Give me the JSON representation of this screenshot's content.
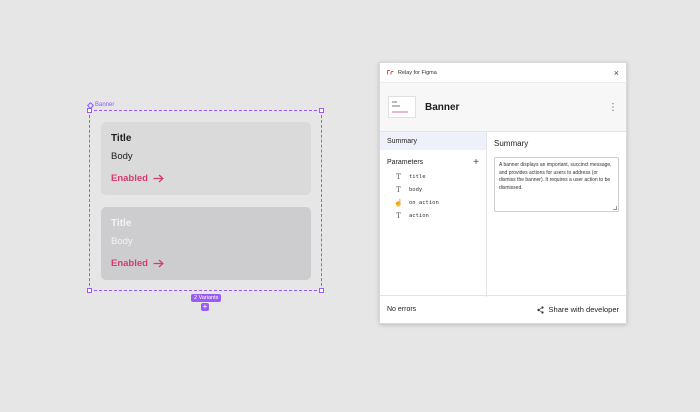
{
  "canvas": {
    "frame_label": "Banner",
    "variants_badge": "2 Variants",
    "add_variant_symbol": "+",
    "cards": [
      {
        "title": "Title",
        "body": "Body",
        "action": "Enabled"
      },
      {
        "title": "Title",
        "body": "Body",
        "action": "Enabled"
      }
    ]
  },
  "plugin": {
    "window_title": "Relay for Figma",
    "close_symbol": "×",
    "component_name": "Banner",
    "more_symbol": "⋯",
    "nav_summary": "Summary",
    "parameters_label": "Parameters",
    "add_parameter_symbol": "+",
    "parameters": [
      {
        "icon": "text-icon",
        "glyph": "T",
        "name": "title"
      },
      {
        "icon": "text-icon",
        "glyph": "T",
        "name": "body"
      },
      {
        "icon": "touch-icon",
        "glyph": "☝",
        "name": "on action"
      },
      {
        "icon": "text-icon",
        "glyph": "T",
        "name": "action"
      }
    ],
    "summary_heading": "Summary",
    "summary_text": "A banner displays an important, succinct message, and provides actions for users to address (or dismiss the banner). It requires a user action to be dismissed.",
    "status": "No errors",
    "share_label": "Share with developer"
  },
  "colors": {
    "accent": "#9b5cf6",
    "action_text": "#d63b6e",
    "background": "#e6e6e6"
  }
}
